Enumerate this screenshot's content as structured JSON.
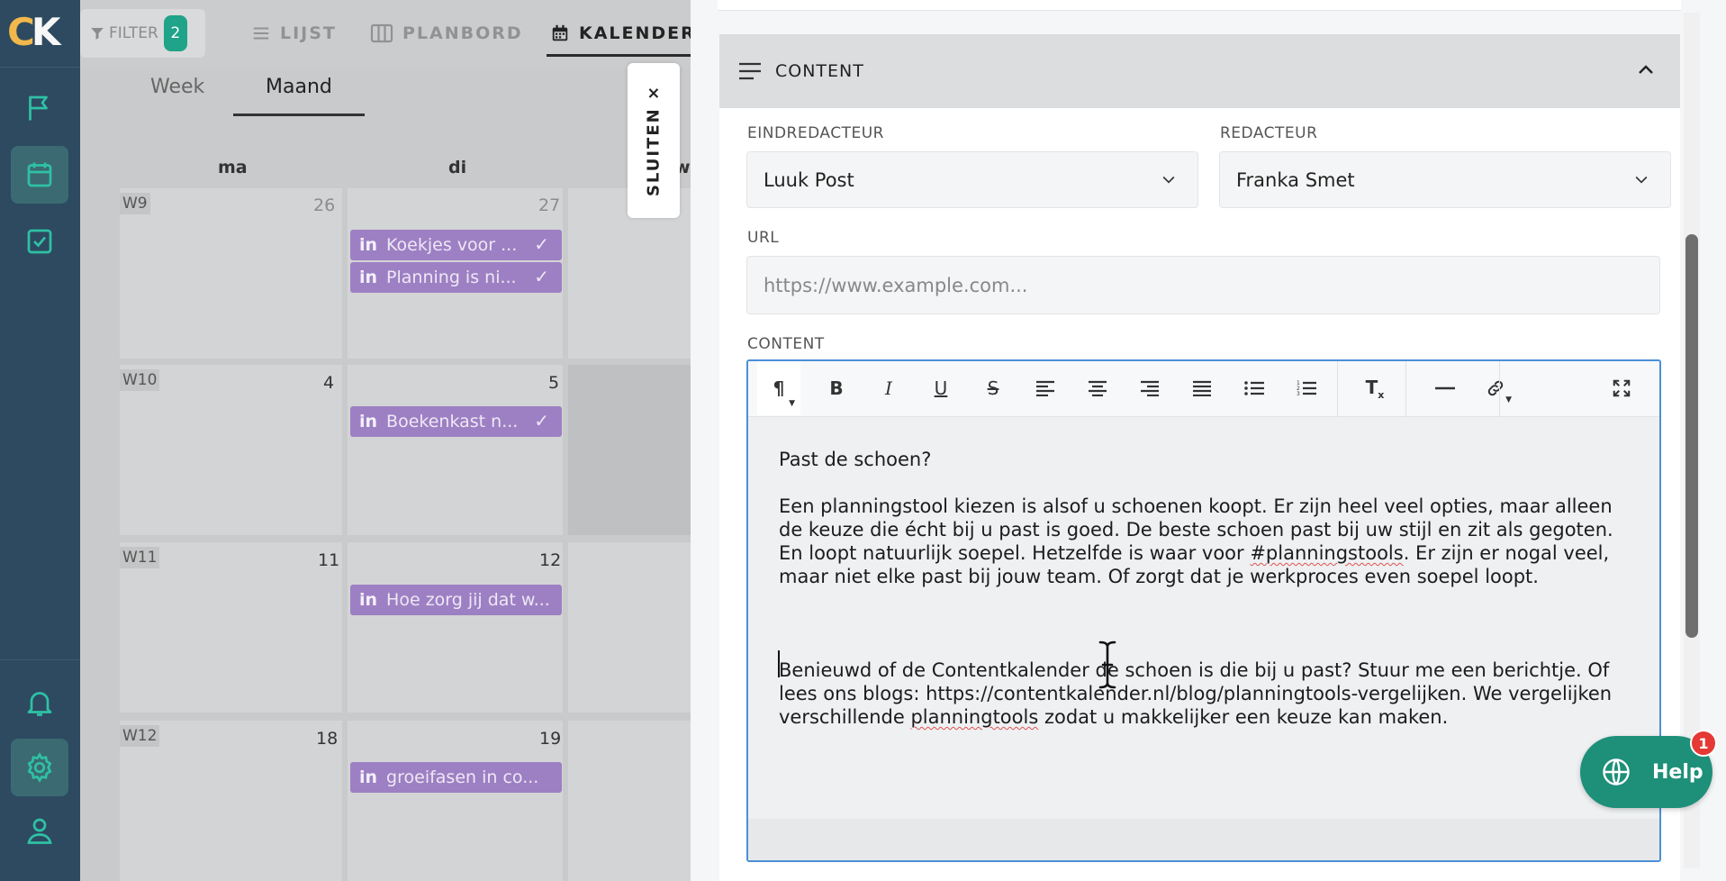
{
  "app": {
    "logo": "CK"
  },
  "nav": {
    "items": [
      "campaigns",
      "calendar",
      "tasks",
      "notifications",
      "settings",
      "profile"
    ]
  },
  "toolbar": {
    "filter_label": "FILTER",
    "filter_count": "2",
    "views": [
      {
        "label": "LIJST"
      },
      {
        "label": "PLANBORD"
      },
      {
        "label": "KALENDER"
      }
    ]
  },
  "calendar": {
    "subtabs": [
      "Week",
      "Maand"
    ],
    "day_headers": [
      "ma",
      "di",
      "wo"
    ],
    "weeks": [
      {
        "label": "W9",
        "days": [
          "26",
          "27"
        ]
      },
      {
        "label": "W10",
        "days": [
          "4",
          "5"
        ]
      },
      {
        "label": "W11",
        "days": [
          "11",
          "12"
        ]
      },
      {
        "label": "W12",
        "days": [
          "18",
          "19"
        ]
      }
    ],
    "events": [
      {
        "title": "Koekjes voor ...",
        "done": true
      },
      {
        "title": "Planning is ni...",
        "done": true
      },
      {
        "title": "Boekenkast n...",
        "done": true
      },
      {
        "title": "Hoe zorg jij dat w...",
        "done": false
      },
      {
        "title": "groeifasen in co...",
        "done": false
      }
    ],
    "linkedin_glyph": "in",
    "check_glyph": "✓"
  },
  "close_tab": {
    "label": "SLUITEN ×"
  },
  "panel": {
    "section_title": "CONTENT",
    "fields": {
      "eindredacteur_label": "EINDREDACTEUR",
      "eindredacteur_value": "Luuk Post",
      "redacteur_label": "REDACTEUR",
      "redacteur_value": "Franka Smet",
      "url_label": "URL",
      "url_placeholder": "https://www.example.com...",
      "content_label": "CONTENT"
    },
    "editor": {
      "p1": "Past de schoen?",
      "p2a": "Een planningstool kiezen is alsof u schoenen koopt. Er zijn heel veel opties, maar alleen de keuze die écht bij u past is goed. De beste schoen past bij uw stijl en zit als gegoten. En loopt natuurlijk soepel. Hetzelfde is waar voor ",
      "p2b": "#planningstools",
      "p2c": ". Er zijn er nogal veel, maar niet elke past bij jouw team. Of zorgt dat je werkproces even soepel loopt.",
      "p3a": "Benieuwd of de Contentkalender de schoen is die bij u past? Stuur me een berichtje. Of lees ons blogs: https://contentkalender.nl/blog/planningtools-vergelijken. We vergelijken verschillende ",
      "p3b": "planningtools",
      "p3c": " zodat u makkelijker een keuze kan maken."
    }
  },
  "help": {
    "label": "Help",
    "badge": "1"
  }
}
